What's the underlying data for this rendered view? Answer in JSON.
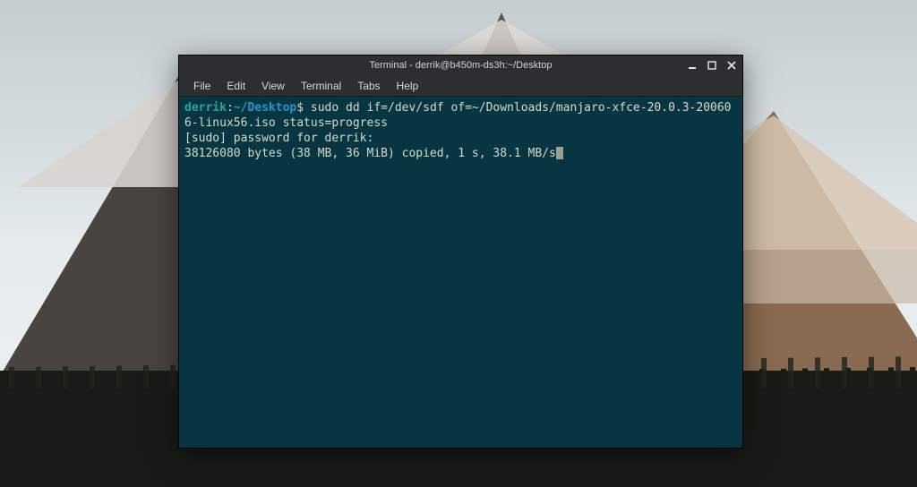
{
  "window": {
    "title": "Terminal - derrik@b450m-ds3h:~/Desktop"
  },
  "menubar": {
    "items": [
      "File",
      "Edit",
      "View",
      "Terminal",
      "Tabs",
      "Help"
    ]
  },
  "prompt": {
    "user_host": "derrik",
    "sep": ":",
    "path": "~/Desktop",
    "dollar": "$"
  },
  "terminal": {
    "command": "sudo dd if=/dev/sdf of=~/Downloads/manjaro-xfce-20.0.3-200606-linux56.iso status=progress",
    "lines": [
      "[sudo] password for derrik:",
      "38126080 bytes (38 MB, 36 MiB) copied, 1 s, 38.1 MB/s"
    ]
  }
}
